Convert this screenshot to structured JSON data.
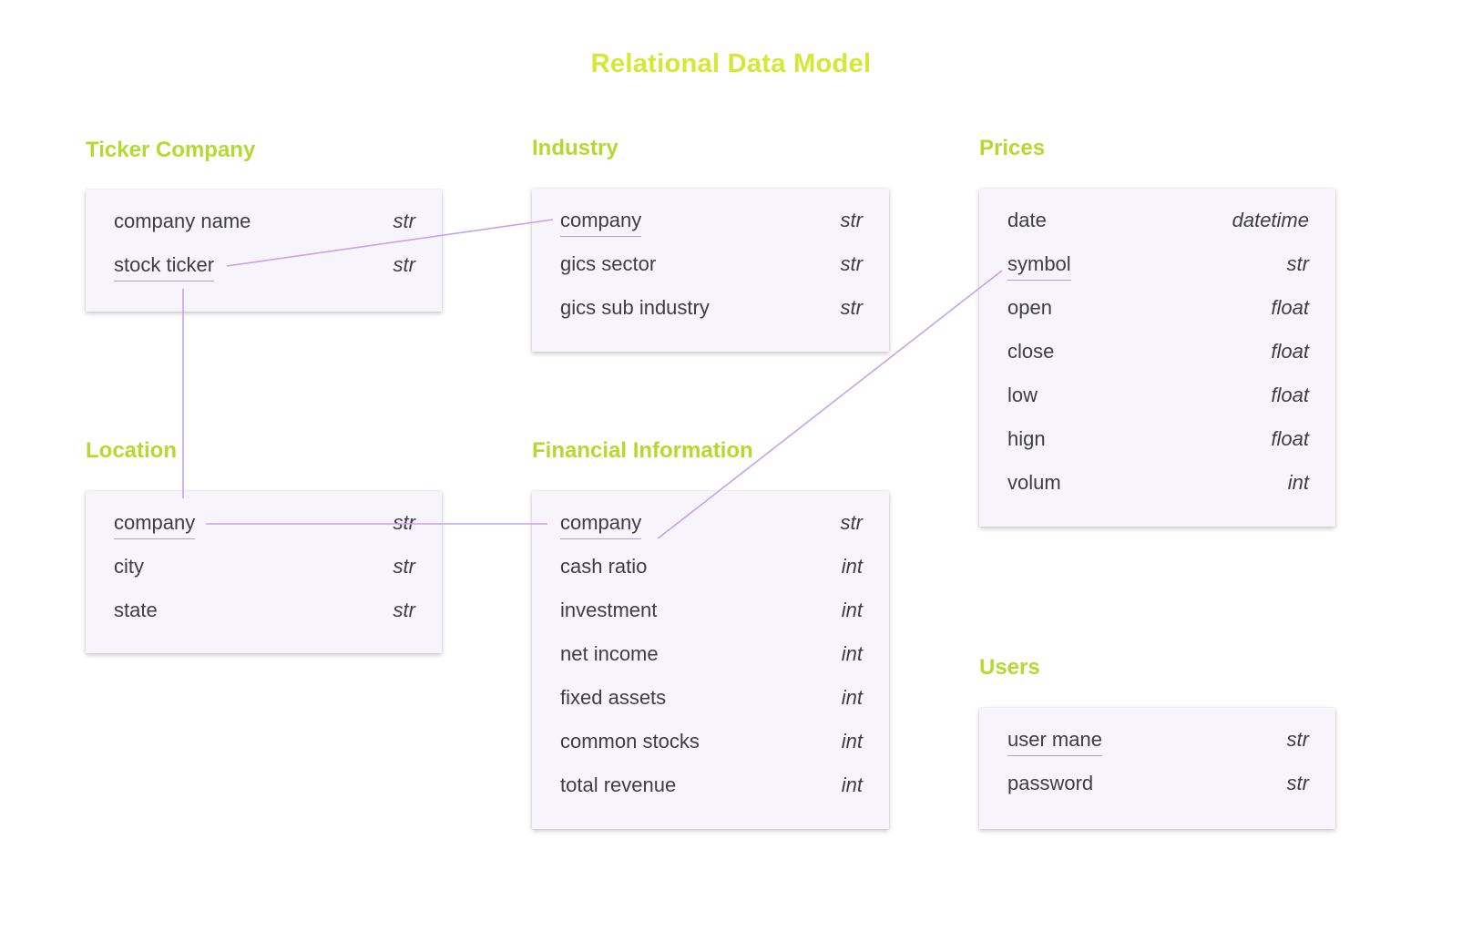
{
  "title": "Relational Data Model",
  "colors": {
    "title": "#d4e835",
    "table_title": "#b5d92f",
    "card_bg": "#f7f5fb",
    "link_line": "#c3a3f0",
    "text": "#3d3d47"
  },
  "tables": [
    {
      "id": "ticker-company",
      "title": "Ticker Company",
      "fields": [
        {
          "name": "company name",
          "type": "str",
          "key": false
        },
        {
          "name": "stock ticker",
          "type": "str",
          "key": true
        }
      ]
    },
    {
      "id": "industry",
      "title": "Industry",
      "fields": [
        {
          "name": "company",
          "type": "str",
          "key": true
        },
        {
          "name": "gics sector",
          "type": "str",
          "key": false
        },
        {
          "name": "gics sub industry",
          "type": "str",
          "key": false
        }
      ]
    },
    {
      "id": "prices",
      "title": "Prices",
      "fields": [
        {
          "name": "date",
          "type": "datetime",
          "key": false
        },
        {
          "name": "symbol",
          "type": "str",
          "key": true
        },
        {
          "name": "open",
          "type": "float",
          "key": false
        },
        {
          "name": "close",
          "type": "float",
          "key": false
        },
        {
          "name": "low",
          "type": "float",
          "key": false
        },
        {
          "name": "hign",
          "type": "float",
          "key": false
        },
        {
          "name": "volum",
          "type": "int",
          "key": false
        }
      ]
    },
    {
      "id": "location",
      "title": "Location",
      "fields": [
        {
          "name": "company",
          "type": "str",
          "key": true
        },
        {
          "name": "city",
          "type": "str",
          "key": false
        },
        {
          "name": "state",
          "type": "str",
          "key": false
        }
      ]
    },
    {
      "id": "financial-information",
      "title": "Financial Information",
      "fields": [
        {
          "name": "company",
          "type": "str",
          "key": true
        },
        {
          "name": "cash ratio",
          "type": "int",
          "key": false
        },
        {
          "name": "investment",
          "type": "int",
          "key": false
        },
        {
          "name": "net income",
          "type": "int",
          "key": false
        },
        {
          "name": "fixed assets",
          "type": "int",
          "key": false
        },
        {
          "name": "common stocks",
          "type": "int",
          "key": false
        },
        {
          "name": "total revenue",
          "type": "int",
          "key": false
        }
      ]
    },
    {
      "id": "users",
      "title": "Users",
      "fields": [
        {
          "name": "user mane",
          "type": "str",
          "key": true
        },
        {
          "name": "password",
          "type": "str",
          "key": false
        }
      ]
    }
  ],
  "relationships": [
    {
      "from": "ticker-company.stock ticker",
      "to": "industry.company"
    },
    {
      "from": "ticker-company.stock ticker",
      "to": "location.company"
    },
    {
      "from": "location.company",
      "to": "financial-information.company"
    },
    {
      "from": "financial-information.company",
      "to": "prices.symbol"
    }
  ]
}
